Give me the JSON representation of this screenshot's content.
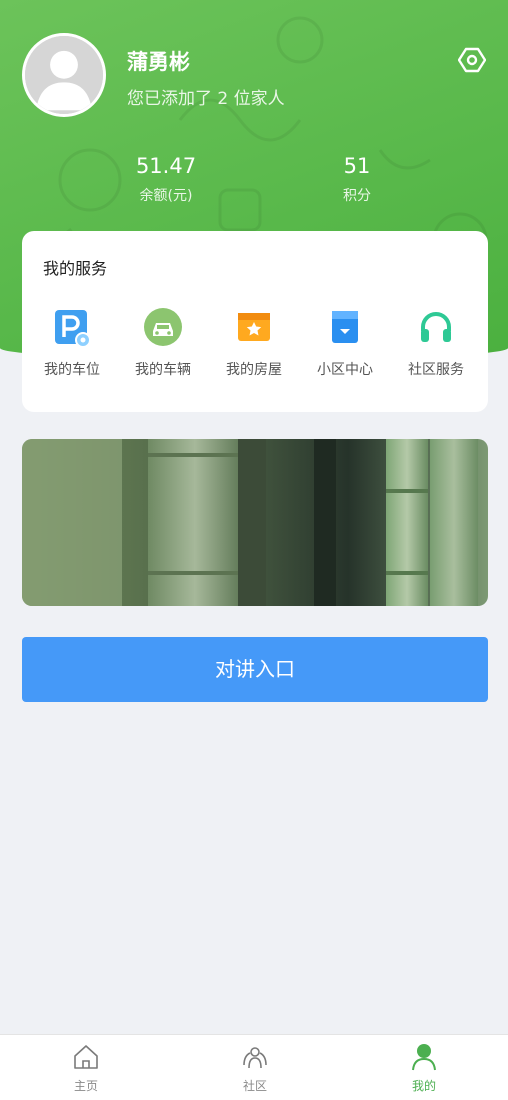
{
  "profile": {
    "name": "蒲勇彬",
    "subtitle": "您已添加了 2 位家人"
  },
  "stats": {
    "balance_value": "51.47",
    "balance_label": "余额(元)",
    "points_value": "51",
    "points_label": "积分"
  },
  "services": {
    "title": "我的服务",
    "items": [
      {
        "label": "我的车位",
        "icon": "parking-icon"
      },
      {
        "label": "我的车辆",
        "icon": "car-icon"
      },
      {
        "label": "我的房屋",
        "icon": "house-icon"
      },
      {
        "label": "小区中心",
        "icon": "community-center-icon"
      },
      {
        "label": "社区服务",
        "icon": "headset-icon"
      }
    ]
  },
  "intercom": {
    "label": "对讲入口"
  },
  "tabbar": {
    "items": [
      {
        "label": "主页",
        "icon": "home-icon"
      },
      {
        "label": "社区",
        "icon": "community-icon"
      },
      {
        "label": "我的",
        "icon": "user-icon"
      }
    ],
    "active": "我的"
  },
  "colors": {
    "header_green": "#58b84a",
    "button_blue": "#4599f8",
    "active_tab": "#4caf50",
    "background": "#eff1f5"
  }
}
